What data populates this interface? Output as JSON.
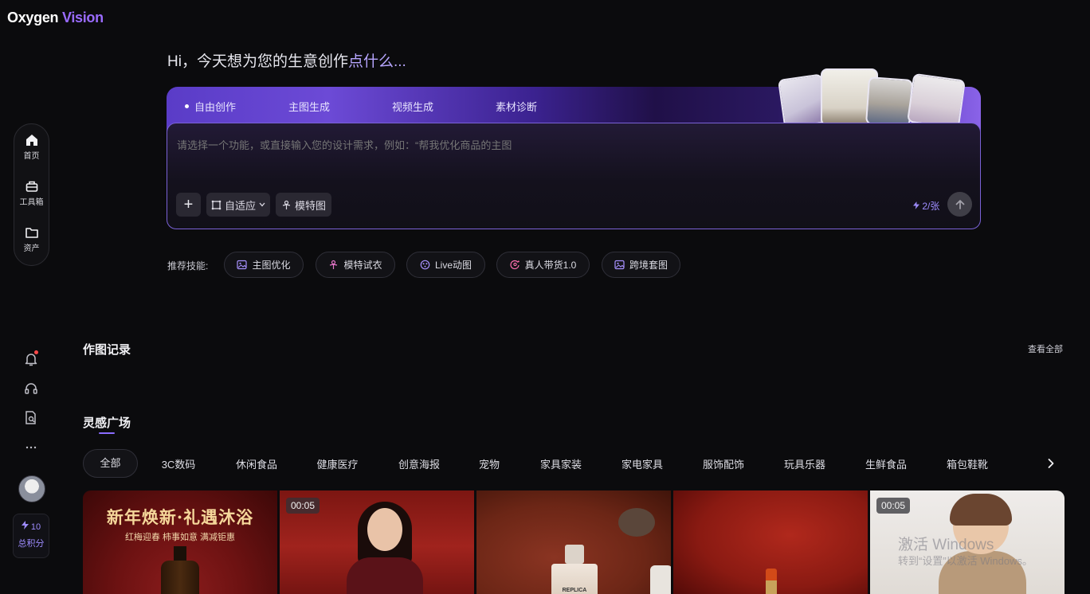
{
  "brand": {
    "name_part1": "Oxygen",
    "name_part2": "Vision"
  },
  "greeting": {
    "part1": "Hi，今天想为您的生意创作",
    "part2": "点什么..."
  },
  "tabs": [
    {
      "label": "自由创作",
      "active": true
    },
    {
      "label": "主图生成",
      "active": false
    },
    {
      "label": "视频生成",
      "active": false
    },
    {
      "label": "素材诊断",
      "active": false
    }
  ],
  "prompt": {
    "placeholder": "请选择一个功能，或直接输入您的设计需求，例如：“帮我优化商品的主图"
  },
  "tools": {
    "add": "+",
    "fit": "自适应",
    "model": "模特图",
    "cost": "2/张"
  },
  "rail": {
    "items": [
      {
        "label": "首页",
        "icon": "home-icon"
      },
      {
        "label": "工具箱",
        "icon": "toolbox-icon"
      },
      {
        "label": "资产",
        "icon": "folder-icon"
      }
    ]
  },
  "points": {
    "value": "10",
    "label": "总积分"
  },
  "skills": {
    "label": "推荐技能:",
    "items": [
      {
        "label": "主图优化",
        "icon": "image-icon"
      },
      {
        "label": "模特试衣",
        "icon": "model-icon"
      },
      {
        "label": "Live动图",
        "icon": "live-icon"
      },
      {
        "label": "真人带货1.0",
        "icon": "person-icon"
      },
      {
        "label": "跨境套图",
        "icon": "image-icon"
      }
    ]
  },
  "records": {
    "title": "作图记录",
    "view_all": "查看全部"
  },
  "inspiration": {
    "title": "灵感广场",
    "categories": [
      "全部",
      "3C数码",
      "休闲食品",
      "健康医疗",
      "创意海报",
      "宠物",
      "家具家装",
      "家电家具",
      "服饰配饰",
      "玩具乐器",
      "生鲜食品",
      "箱包鞋靴"
    ],
    "active_category": "全部"
  },
  "gallery": {
    "card1": {
      "headline": "新年焕新·礼遇沐浴",
      "subline": "红梅迎春 柿事如意 满减钜惠"
    },
    "card2": {
      "duration": "00:05"
    },
    "card3": {
      "label": "REPLICA"
    },
    "card5": {
      "duration": "00:05"
    }
  },
  "watermark": {
    "line1": "激活 Windows",
    "line2": "转到“设置”以激活 Windows。"
  },
  "colors": {
    "accent": "#8a6cff",
    "background": "#0b0b0d",
    "panel_border": "#7a62d6"
  }
}
